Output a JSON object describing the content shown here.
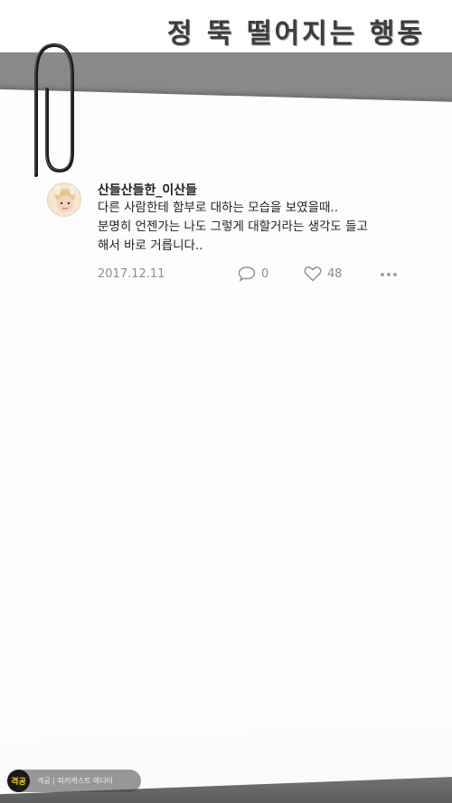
{
  "header": {
    "title": "정 뚝 떨어지는 행동"
  },
  "post": {
    "author": "산들산들한_이산들",
    "lines": [
      "다른 사람한테 함부로 대하는 모습을 보였을때..",
      "분명히 언젠가는 나도 그렇게 대할거라는 생각도 들고",
      "해서 바로 거릅니다.."
    ],
    "date": "2017.12.11",
    "comments": "0",
    "likes": "48",
    "avatar_icon": "avatar-portrait"
  },
  "badge": {
    "logo": "격공",
    "text": "격공 | 피키캐스트 에디터"
  },
  "colors": {
    "backdrop": "#7a7a7a",
    "paper": "#fdfdfd",
    "meta": "#8e8e8e",
    "badge_logo": "#f5d50a"
  }
}
